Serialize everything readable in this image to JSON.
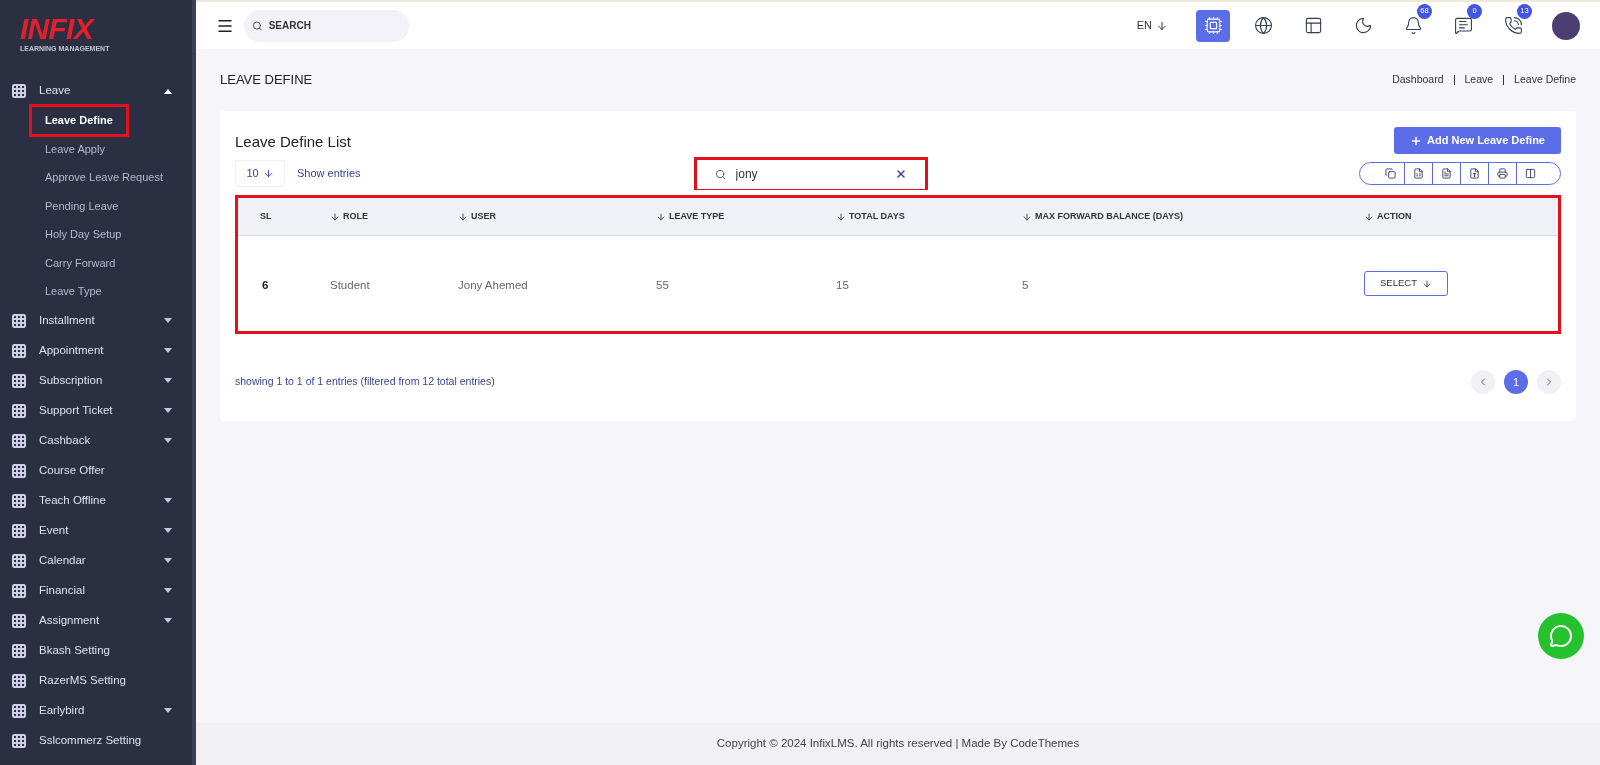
{
  "logo": {
    "brand": "INFIX",
    "tagline": "LEARNING MANAGEMENT"
  },
  "sidebar": {
    "items": [
      {
        "kind": "group",
        "label": "Leave",
        "expanded": true,
        "children": [
          {
            "label": "Leave Define",
            "selected": true,
            "highlighted": true
          },
          {
            "label": "Leave Apply",
            "selected": false,
            "highlighted": false
          },
          {
            "label": "Approve Leave Request",
            "selected": false,
            "highlighted": false
          },
          {
            "label": "Pending Leave",
            "selected": false,
            "highlighted": false
          },
          {
            "label": "Holy Day Setup",
            "selected": false,
            "highlighted": false
          },
          {
            "label": "Carry Forward",
            "selected": false,
            "highlighted": false
          },
          {
            "label": "Leave Type",
            "selected": false,
            "highlighted": false
          }
        ]
      },
      {
        "kind": "group",
        "label": "Installment",
        "expanded": false
      },
      {
        "kind": "group",
        "label": "Appointment",
        "expanded": false
      },
      {
        "kind": "group",
        "label": "Subscription",
        "expanded": false
      },
      {
        "kind": "group",
        "label": "Support Ticket",
        "expanded": false
      },
      {
        "kind": "group",
        "label": "Cashback",
        "expanded": false
      },
      {
        "kind": "link",
        "label": "Course Offer"
      },
      {
        "kind": "group",
        "label": "Teach Offline",
        "expanded": false
      },
      {
        "kind": "group",
        "label": "Event",
        "expanded": false
      },
      {
        "kind": "group",
        "label": "Calendar",
        "expanded": false
      },
      {
        "kind": "group",
        "label": "Financial",
        "expanded": false
      },
      {
        "kind": "group",
        "label": "Assignment",
        "expanded": false
      },
      {
        "kind": "link",
        "label": "Bkash Setting"
      },
      {
        "kind": "link",
        "label": "RazerMS Setting"
      },
      {
        "kind": "group",
        "label": "Earlybird",
        "expanded": false
      },
      {
        "kind": "link",
        "label": "Sslcommerz Setting"
      }
    ]
  },
  "topbar": {
    "search_placeholder": "SEARCH",
    "language": "EN",
    "icons": [
      {
        "kind": "ai",
        "selected": true
      },
      {
        "kind": "globe",
        "selected": false
      },
      {
        "kind": "layout",
        "selected": false
      },
      {
        "kind": "moon",
        "selected": false
      },
      {
        "kind": "bell",
        "selected": false,
        "badge": "68"
      },
      {
        "kind": "chat",
        "selected": false,
        "badge": "0"
      },
      {
        "kind": "phone",
        "selected": false,
        "badge": "13"
      }
    ]
  },
  "page": {
    "title": "LEAVE DEFINE",
    "breadcrumbs": [
      "Dashboard",
      "Leave",
      "Leave Define"
    ]
  },
  "card": {
    "title": "Leave Define List",
    "add_button": "Add New Leave Define",
    "page_size": "10",
    "show_entries": "Show entries",
    "search": {
      "value": "jony",
      "highlighted": true
    },
    "table": {
      "highlighted": true,
      "columns": [
        {
          "label": "SL",
          "sortable": false
        },
        {
          "label": "ROLE",
          "sortable": true
        },
        {
          "label": "USER",
          "sortable": true
        },
        {
          "label": "LEAVE TYPE",
          "sortable": true
        },
        {
          "label": "TOTAL DAYS",
          "sortable": true
        },
        {
          "label": "MAX FORWARD BALANCE (DAYS)",
          "sortable": true
        },
        {
          "label": "ACTION",
          "sortable": true
        }
      ],
      "rows": [
        {
          "sl": "6",
          "role": "Student",
          "user": "Jony Ahemed",
          "leave_type": "55",
          "total_days": "15",
          "max_forward": "5",
          "action": "SELECT"
        }
      ]
    },
    "info": "showing 1 to 1 of 1 entries (filtered from 12 total entries)",
    "pages": [
      {
        "label": "1",
        "selected": true
      }
    ]
  },
  "footer": "Copyright © 2024 InfixLMS. All rights reserved | Made By CodeThemes"
}
